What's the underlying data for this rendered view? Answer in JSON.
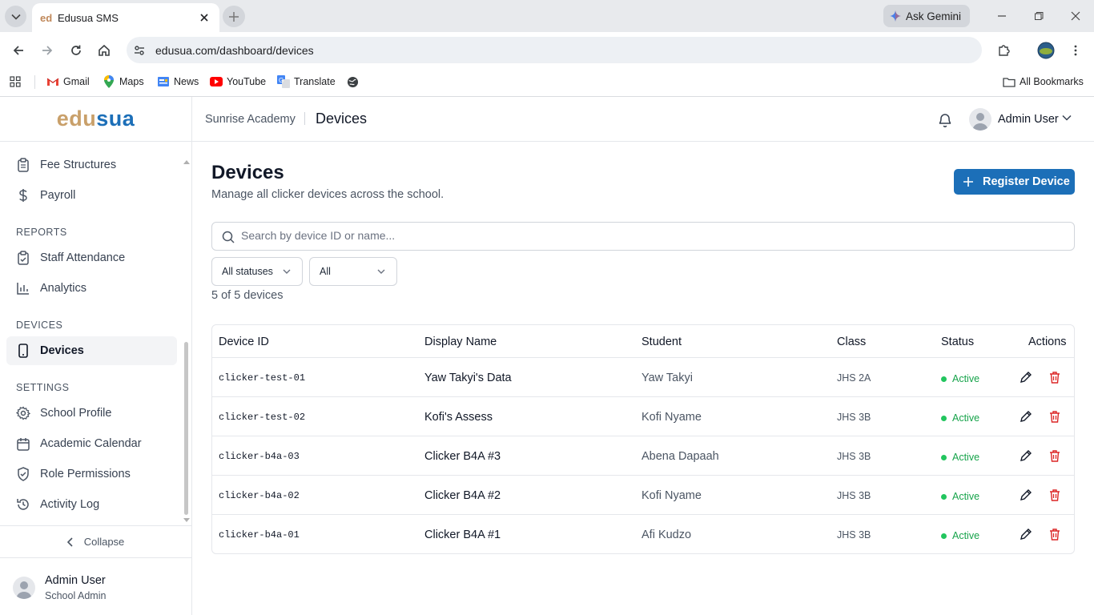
{
  "browser": {
    "tab_title": "Edusua SMS",
    "favicon_text": "ed",
    "url": "edusua.com/dashboard/devices",
    "gemini_label": "Ask Gemini",
    "bookmarks": [
      {
        "label": "Gmail",
        "icon": "gmail-icon"
      },
      {
        "label": "Maps",
        "icon": "maps-icon"
      },
      {
        "label": "News",
        "icon": "news-icon"
      },
      {
        "label": "YouTube",
        "icon": "youtube-icon"
      },
      {
        "label": "Translate",
        "icon": "translate-icon"
      }
    ],
    "all_bookmarks": "All Bookmarks"
  },
  "logo": {
    "part1": "edu",
    "part2": "sua"
  },
  "sidebar": {
    "items_top": [
      {
        "label": "Fee Structures",
        "icon": "clipboard-icon"
      },
      {
        "label": "Payroll",
        "icon": "dollar-icon"
      }
    ],
    "sections": [
      {
        "label": "REPORTS",
        "items": [
          {
            "label": "Staff Attendance",
            "icon": "clipboard-check-icon"
          },
          {
            "label": "Analytics",
            "icon": "bar-chart-icon"
          }
        ]
      },
      {
        "label": "DEVICES",
        "items": [
          {
            "label": "Devices",
            "icon": "phone-icon",
            "active": true
          }
        ]
      },
      {
        "label": "SETTINGS",
        "items": [
          {
            "label": "School Profile",
            "icon": "gear-icon"
          },
          {
            "label": "Academic Calendar",
            "icon": "calendar-icon"
          },
          {
            "label": "Role Permissions",
            "icon": "shield-check-icon"
          },
          {
            "label": "Activity Log",
            "icon": "history-icon"
          }
        ]
      }
    ],
    "collapse_label": "Collapse",
    "user": {
      "name": "Admin User",
      "role": "School Admin"
    }
  },
  "header": {
    "school": "Sunrise Academy",
    "page": "Devices",
    "user_name": "Admin User"
  },
  "main": {
    "title": "Devices",
    "subtitle": "Manage all clicker devices across the school.",
    "register_button": "Register Device",
    "search_placeholder": "Search by device ID or name...",
    "filters": {
      "status": "All statuses",
      "class": "All"
    },
    "count_text": "5 of 5 devices",
    "columns": [
      "Device ID",
      "Display Name",
      "Student",
      "Class",
      "Status",
      "Actions"
    ],
    "rows": [
      {
        "device_id": "clicker-test-01",
        "display_name": "Yaw Takyi's Data",
        "student": "Yaw Takyi",
        "class": "JHS 2A",
        "status": "Active"
      },
      {
        "device_id": "clicker-test-02",
        "display_name": "Kofi's Assess",
        "student": "Kofi Nyame",
        "class": "JHS 3B",
        "status": "Active"
      },
      {
        "device_id": "clicker-b4a-03",
        "display_name": "Clicker B4A #3",
        "student": "Abena Dapaah",
        "class": "JHS 3B",
        "status": "Active"
      },
      {
        "device_id": "clicker-b4a-02",
        "display_name": "Clicker B4A #2",
        "student": "Kofi Nyame",
        "class": "JHS 3B",
        "status": "Active"
      },
      {
        "device_id": "clicker-b4a-01",
        "display_name": "Clicker B4A #1",
        "student": "Afi Kudzo",
        "class": "JHS 3B",
        "status": "Active"
      }
    ]
  },
  "colors": {
    "brand_blue": "#1c6fb8",
    "brand_gold": "#c9a06a",
    "status_active": "#22c55e",
    "delete_red": "#dc2626"
  }
}
